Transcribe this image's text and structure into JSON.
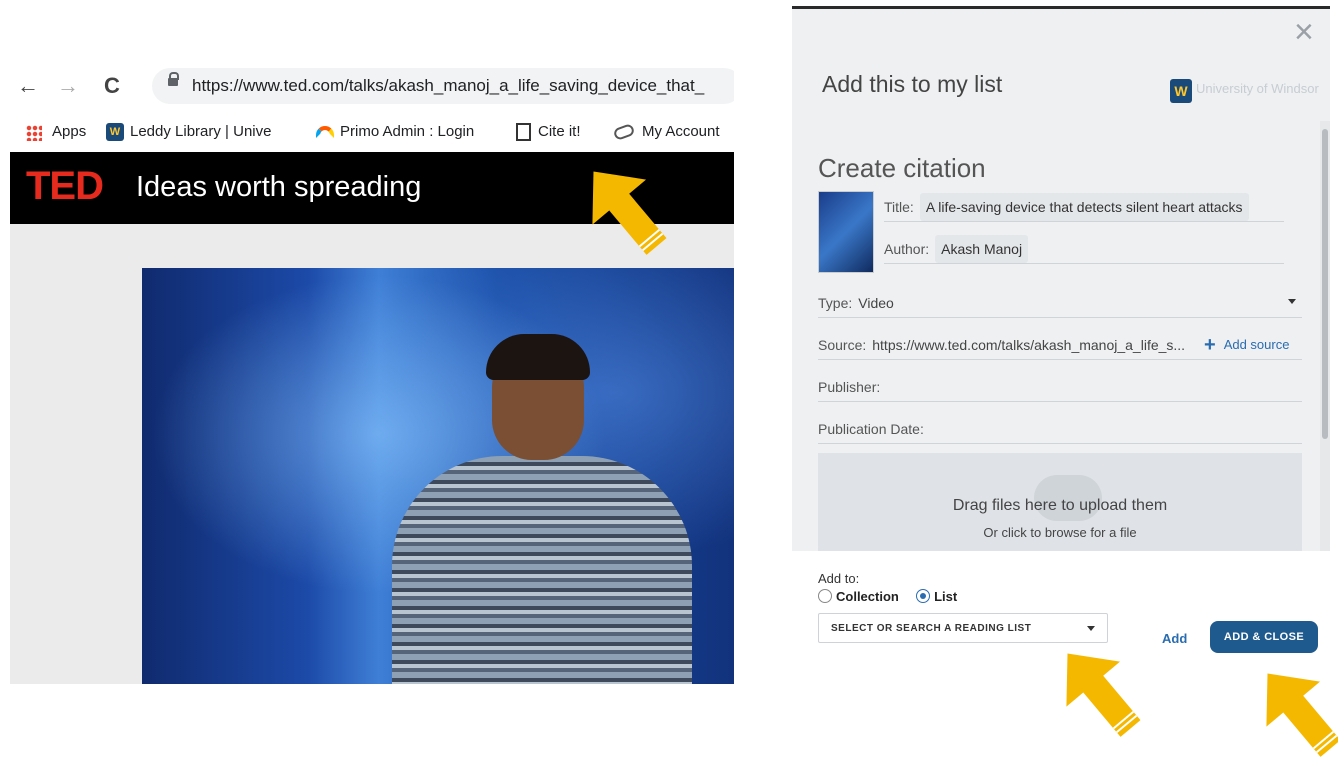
{
  "browser": {
    "nav": {
      "back": "←",
      "forward": "→",
      "reload": "C"
    },
    "url": "https://www.ted.com/talks/akash_manoj_a_life_saving_device_that_",
    "bookmarks": [
      {
        "label": "Apps",
        "icon": "apps-grid-icon"
      },
      {
        "label": "Leddy Library | Unive",
        "icon": "uwindsor-logo-icon"
      },
      {
        "label": "Primo Admin : Login",
        "icon": "primo-rainbow-icon"
      },
      {
        "label": "Cite it!",
        "icon": "document-icon"
      },
      {
        "label": "My Account",
        "icon": "link-icon"
      }
    ],
    "ted": {
      "logo": "TED",
      "tagline": "Ideas worth spreading"
    },
    "highlight_color": "#f5b800"
  },
  "dialog": {
    "close": "×",
    "title": "Add this to my list",
    "institution": "University of Windsor",
    "logo_letter": "W",
    "section_title": "Create citation",
    "fields": {
      "title_label": "Title:",
      "title_value": "A life-saving device that detects silent heart attacks",
      "author_label": "Author:",
      "author_value": "Akash Manoj",
      "type_label": "Type:",
      "type_value": "Video",
      "source_label": "Source:",
      "source_value": "https://www.ted.com/talks/akash_manoj_a_life_s...",
      "add_source": "Add source",
      "add_source_plus": "+",
      "publisher_label": "Publisher:",
      "pubdate_label": "Publication Date:"
    },
    "dropzone": {
      "line1": "Drag files here to upload them",
      "line2": "Or click to browse for a file"
    },
    "footer": {
      "add_to_label": "Add to:",
      "collection_label": "Collection",
      "list_label": "List",
      "selected": "List",
      "list_placeholder": "SELECT OR SEARCH A READING LIST",
      "add_label": "Add",
      "add_close_label": "ADD & CLOSE"
    },
    "colors": {
      "primary": "#1f5a8e",
      "link": "#2a6cb0",
      "arrow": "#f5b800"
    }
  }
}
